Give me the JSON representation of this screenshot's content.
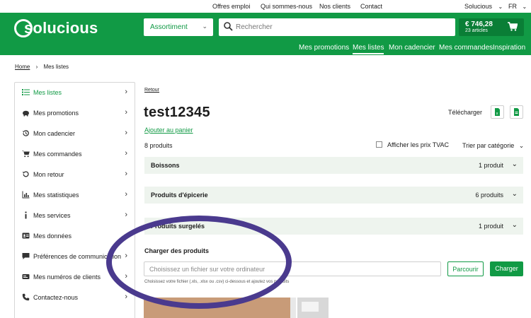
{
  "topbar": {
    "links": [
      "Offres emploi",
      "Qui sommes-nous",
      "Nos clients",
      "Contact"
    ],
    "account": "Solucious",
    "language": "FR"
  },
  "header": {
    "logo": "solucious",
    "assortment_label": "Assortiment",
    "search_placeholder": "Rechercher",
    "cart_amount": "€ 746,28",
    "cart_count": "23 articles",
    "nav": [
      "Mes promotions",
      "Mes listes",
      "Mon cadencier",
      "Mes commandes",
      "Inspiration"
    ],
    "active_nav": "Mes listes"
  },
  "breadcrumb": {
    "home": "Home",
    "current": "Mes listes"
  },
  "sidebar": {
    "items": [
      {
        "label": "Mes listes",
        "icon": "list-icon"
      },
      {
        "label": "Mes promotions",
        "icon": "piggy-bank-icon"
      },
      {
        "label": "Mon cadencier",
        "icon": "history-icon"
      },
      {
        "label": "Mes commandes",
        "icon": "cart-icon"
      },
      {
        "label": "Mon retour",
        "icon": "return-icon"
      },
      {
        "label": "Mes statistiques",
        "icon": "bar-chart-icon"
      },
      {
        "label": "Mes services",
        "icon": "info-icon"
      },
      {
        "label": "Mes données",
        "icon": "id-card-icon"
      },
      {
        "label": "Préférences de communication",
        "icon": "chat-icon"
      },
      {
        "label": "Mes numéros de clients",
        "icon": "card-icon"
      },
      {
        "label": "Contactez-nous",
        "icon": "phone-icon"
      }
    ]
  },
  "main": {
    "back": "Retour",
    "title": "test12345",
    "download_label": "Télécharger",
    "add_to_cart": "Ajouter au panier",
    "product_count": "8 produits",
    "tvac_label": "Afficher les prix TVAC",
    "sort_label": "Trier par catégorie",
    "categories": [
      {
        "name": "Boissons",
        "count": "1 produit"
      },
      {
        "name": "Produits d'épicerie",
        "count": "6 produits"
      },
      {
        "name": "Produits surgelés",
        "count": "1 produit"
      }
    ],
    "upload": {
      "title": "Charger des produits",
      "placeholder": "Choisissez un fichier sur votre ordinateur",
      "browse": "Parcourir",
      "load": "Charger",
      "hint": "Choisissez votre fichier (.xls, .xlsx ou .csv) ci-dessous et ajoutez vos produits"
    }
  },
  "colors": {
    "brand_green": "#119a45",
    "annotation_purple": "#4a3a8e"
  }
}
